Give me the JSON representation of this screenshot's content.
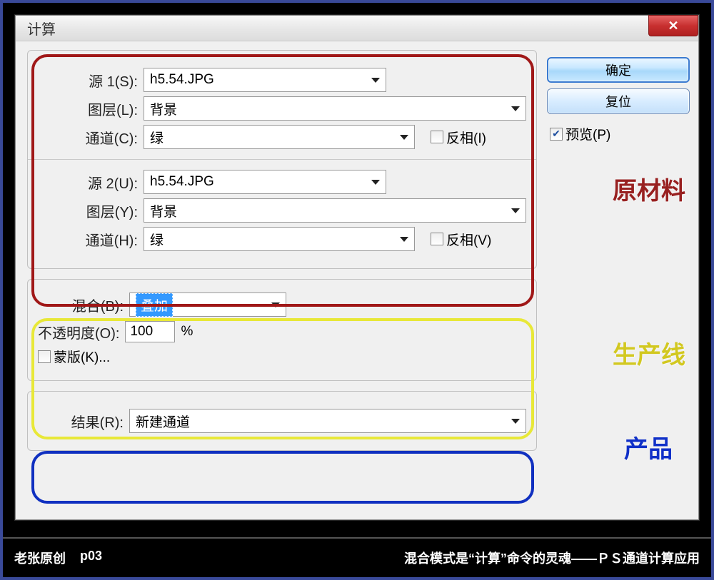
{
  "dialog": {
    "title": "计算",
    "close_glyph": "✕",
    "source1": {
      "label": "源 1(S):",
      "file": "h5.54.JPG",
      "layer_label": "图层(L):",
      "layer_value": "背景",
      "channel_label": "通道(C):",
      "channel_value": "绿",
      "invert_label": "反相(I)"
    },
    "source2": {
      "label": "源 2(U):",
      "file": "h5.54.JPG",
      "layer_label": "图层(Y):",
      "layer_value": "背景",
      "channel_label": "通道(H):",
      "channel_value": "绿",
      "invert_label": "反相(V)"
    },
    "blending": {
      "label": "混合(B):",
      "value": "叠加",
      "opacity_label": "不透明度(O):",
      "opacity_value": "100",
      "opacity_unit": "%",
      "mask_label": "蒙版(K)..."
    },
    "result": {
      "label": "结果(R):",
      "value": "新建通道"
    },
    "buttons": {
      "ok": "确定",
      "reset": "复位",
      "preview": "预览(P)"
    }
  },
  "annotations": {
    "red": "原材料",
    "yellow": "生产线",
    "blue": "产品"
  },
  "footer": {
    "left1": "老张原创",
    "left2": "p03",
    "right": "混合模式是“计算”命令的灵魂——ＰＳ通道计算应用"
  }
}
